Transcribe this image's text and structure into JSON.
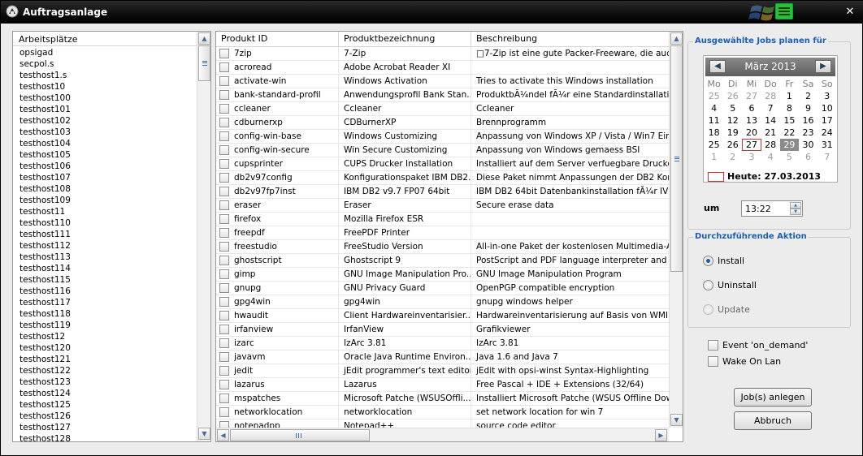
{
  "window": {
    "title": "Auftragsanlage",
    "close_glyph": "✕"
  },
  "hosts": {
    "header": "Arbeitsplätze",
    "items": [
      "opsigad",
      "secpol.s",
      "testhost1.s",
      "testhost10",
      "testhost100",
      "testhost101",
      "testhost102",
      "testhost103",
      "testhost104",
      "testhost105",
      "testhost106",
      "testhost107",
      "testhost108",
      "testhost109",
      "testhost11",
      "testhost110",
      "testhost111",
      "testhost112",
      "testhost113",
      "testhost114",
      "testhost115",
      "testhost116",
      "testhost117",
      "testhost118",
      "testhost119",
      "testhost12",
      "testhost120",
      "testhost121",
      "testhost122",
      "testhost123",
      "testhost124",
      "testhost125",
      "testhost126",
      "testhost127",
      "testhost128"
    ]
  },
  "products": {
    "columns": [
      "Produkt ID",
      "Produktbezeichnung",
      "Beschreibung"
    ],
    "rows": [
      [
        "7zip",
        "7-Zip",
        "□7-Zip ist eine gute Packer-Freeware, die auch c"
      ],
      [
        "acroread",
        "Adobe Acrobat Reader XI",
        ""
      ],
      [
        "activate-win",
        "Windows Activation",
        "Tries to activate this Windows installation"
      ],
      [
        "bank-standard-profil",
        "Anwendungsprofil Bank Stan...",
        "ProduktbÃ¼ndel fÃ¼r eine Standardinstallation"
      ],
      [
        "ccleaner",
        "Ccleaner",
        "Ccleaner"
      ],
      [
        "cdburnerxp",
        "CDBurnerXP",
        "Brennprogramm"
      ],
      [
        "config-win-base",
        "Windows Customizing",
        "Anpassung von Windows XP / Vista / Win7 Einstel"
      ],
      [
        "config-win-secure",
        "Win Secure Customizing",
        "Anpassung von Windows gemaess BSI"
      ],
      [
        "cupsprinter",
        "CUPS Drucker Installation",
        "Installiert auf dem Server verfuegbare Drucker al"
      ],
      [
        "db2v97config",
        "Konfigurationspaket IBM DB2...",
        "Diese Paket nimmt Anpassungen der DB2 Konfigur"
      ],
      [
        "db2v97fp7inst",
        "IBM DB2 v9.7 FP07 64bit",
        "IBM DB2 64bit Datenbankinstallation fÃ¼r IVS"
      ],
      [
        "eraser",
        "Eraser",
        "Secure erase data"
      ],
      [
        "firefox",
        "Mozilla Firefox ESR",
        ""
      ],
      [
        "freepdf",
        "FreePDF Printer",
        ""
      ],
      [
        "freestudio",
        "FreeStudio Version",
        "All-in-one Paket der kostenlosen Multimedia-Anwe"
      ],
      [
        "ghostscript",
        "Ghostscript 9",
        "PostScript and PDF language interpreter and prev"
      ],
      [
        "gimp",
        "GNU Image Manipulation Pro...",
        "GNU Image Manipulation Program"
      ],
      [
        "gnupg",
        "GNU Privacy Guard",
        "OpenPGP compatible encryption"
      ],
      [
        "gpg4win",
        "gpg4win",
        "gnupg windows helper"
      ],
      [
        "hwaudit",
        "Client Hardwareinventarisier...",
        "Hardwareinventarisierung auf Basis von WMI / Re"
      ],
      [
        "irfanview",
        "IrfanView",
        "Grafikviewer"
      ],
      [
        "izarc",
        "IzArc 3.81",
        "IzArc 3.81"
      ],
      [
        "javavm",
        "Oracle Java Runtime Environ...",
        "Java 1.6 and Java 7"
      ],
      [
        "jedit",
        "jEdit programmer's text editor",
        "jEdit with opsi-winst Syntax-Highlighting"
      ],
      [
        "lazarus",
        "Lazarus",
        "Free Pascal + IDE + Extensions (32/64)"
      ],
      [
        "mspatches",
        "Microsoft Patche (WSUSOffli...",
        "Installiert Microsoft Patche (WSUS Offline Downlo"
      ],
      [
        "networklocation",
        "networklocation",
        "set network location for win 7"
      ],
      [
        "notepadpp",
        "Notepad++",
        "source code editor"
      ]
    ]
  },
  "schedule": {
    "legend": "Ausgewählte Jobs planen für",
    "month_label": "März 2013",
    "weekdays": [
      "Mo",
      "Di",
      "Mi",
      "Do",
      "Fr",
      "Sa",
      "So"
    ],
    "weeks": [
      [
        "25",
        "26",
        "27",
        "28",
        "1",
        "2",
        "3"
      ],
      [
        "4",
        "5",
        "6",
        "7",
        "8",
        "9",
        "10"
      ],
      [
        "11",
        "12",
        "13",
        "14",
        "15",
        "16",
        "17"
      ],
      [
        "18",
        "19",
        "20",
        "21",
        "22",
        "23",
        "24"
      ],
      [
        "25",
        "26",
        "27",
        "28",
        "29",
        "30",
        "31"
      ],
      [
        "1",
        "2",
        "3",
        "4",
        "5",
        "6",
        "7"
      ]
    ],
    "today_text": "Heute: 27.03.2013",
    "time_label": "um",
    "time_value": "13:22"
  },
  "action": {
    "legend": "Durchzuführende Aktion",
    "options": [
      "Install",
      "Uninstall",
      "Update"
    ],
    "selected": "Install"
  },
  "options": {
    "event_label": "Event 'on_demand'",
    "wol_label": "Wake On Lan"
  },
  "buttons": {
    "create": "Job(s) anlegen",
    "cancel": "Abbruch"
  }
}
